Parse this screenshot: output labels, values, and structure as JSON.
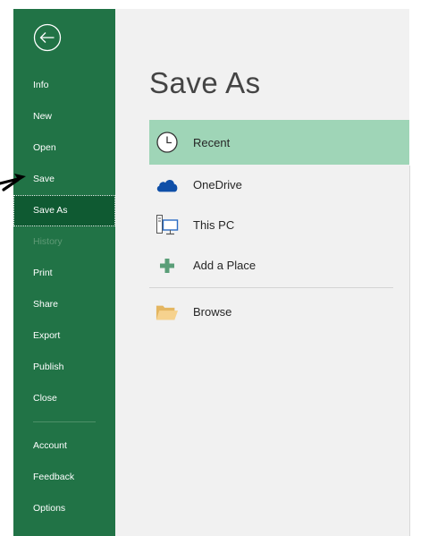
{
  "sidebar": {
    "items": [
      {
        "label": "Info",
        "state": "normal"
      },
      {
        "label": "New",
        "state": "normal"
      },
      {
        "label": "Open",
        "state": "normal"
      },
      {
        "label": "Save",
        "state": "normal"
      },
      {
        "label": "Save As",
        "state": "active"
      },
      {
        "label": "History",
        "state": "disabled"
      },
      {
        "label": "Print",
        "state": "normal"
      },
      {
        "label": "Share",
        "state": "normal"
      },
      {
        "label": "Export",
        "state": "normal"
      },
      {
        "label": "Publish",
        "state": "normal"
      },
      {
        "label": "Close",
        "state": "normal"
      }
    ],
    "bottom_items": [
      {
        "label": "Account"
      },
      {
        "label": "Feedback"
      },
      {
        "label": "Options"
      }
    ]
  },
  "main": {
    "title": "Save As",
    "places": [
      {
        "label": "Recent",
        "icon": "clock-icon",
        "selected": true
      },
      {
        "label": "OneDrive",
        "icon": "cloud-icon",
        "selected": false
      },
      {
        "label": "This PC",
        "icon": "computer-icon",
        "selected": false
      },
      {
        "label": "Add a Place",
        "icon": "plus-icon",
        "selected": false
      }
    ],
    "browse": {
      "label": "Browse",
      "icon": "folder-icon"
    }
  },
  "colors": {
    "sidebar_bg": "#217346",
    "sidebar_active": "#0f5a32",
    "selected_place": "#9fd5b7",
    "main_bg": "#f1f1f1"
  }
}
